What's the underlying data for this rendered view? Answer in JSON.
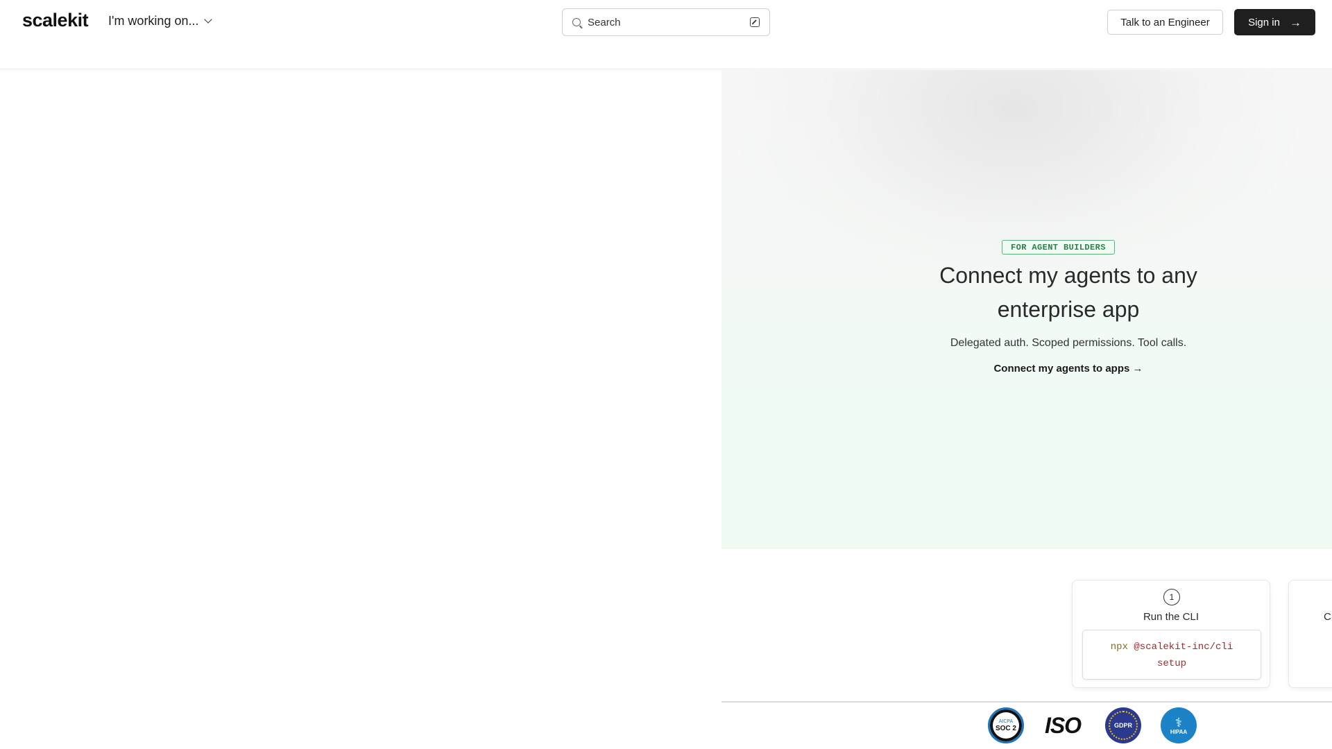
{
  "header": {
    "logo": "scalekit",
    "working_label": "I'm working on...",
    "search_placeholder": "Search",
    "talk_button": "Talk to an Engineer",
    "signin_button": "Sign in"
  },
  "hero": {
    "badge": "FOR AGENT BUILDERS",
    "title": "Connect my agents to any enterprise app",
    "subtitle": "Delegated auth. Scoped permissions. Tool calls.",
    "link": "Connect my agents to apps →"
  },
  "steps": [
    {
      "number": "1",
      "title": "Run the CLI",
      "code_cmd": "npx",
      "code_pkg": "@scalekit-inc/cli",
      "code_arg": "setup"
    },
    {
      "title": "C"
    }
  ],
  "certifications": {
    "soc_top": "AICPA",
    "soc_main": "SOC 2",
    "iso": "ISO",
    "gdpr": "GDPR",
    "hipaa": "HIPAA"
  }
}
